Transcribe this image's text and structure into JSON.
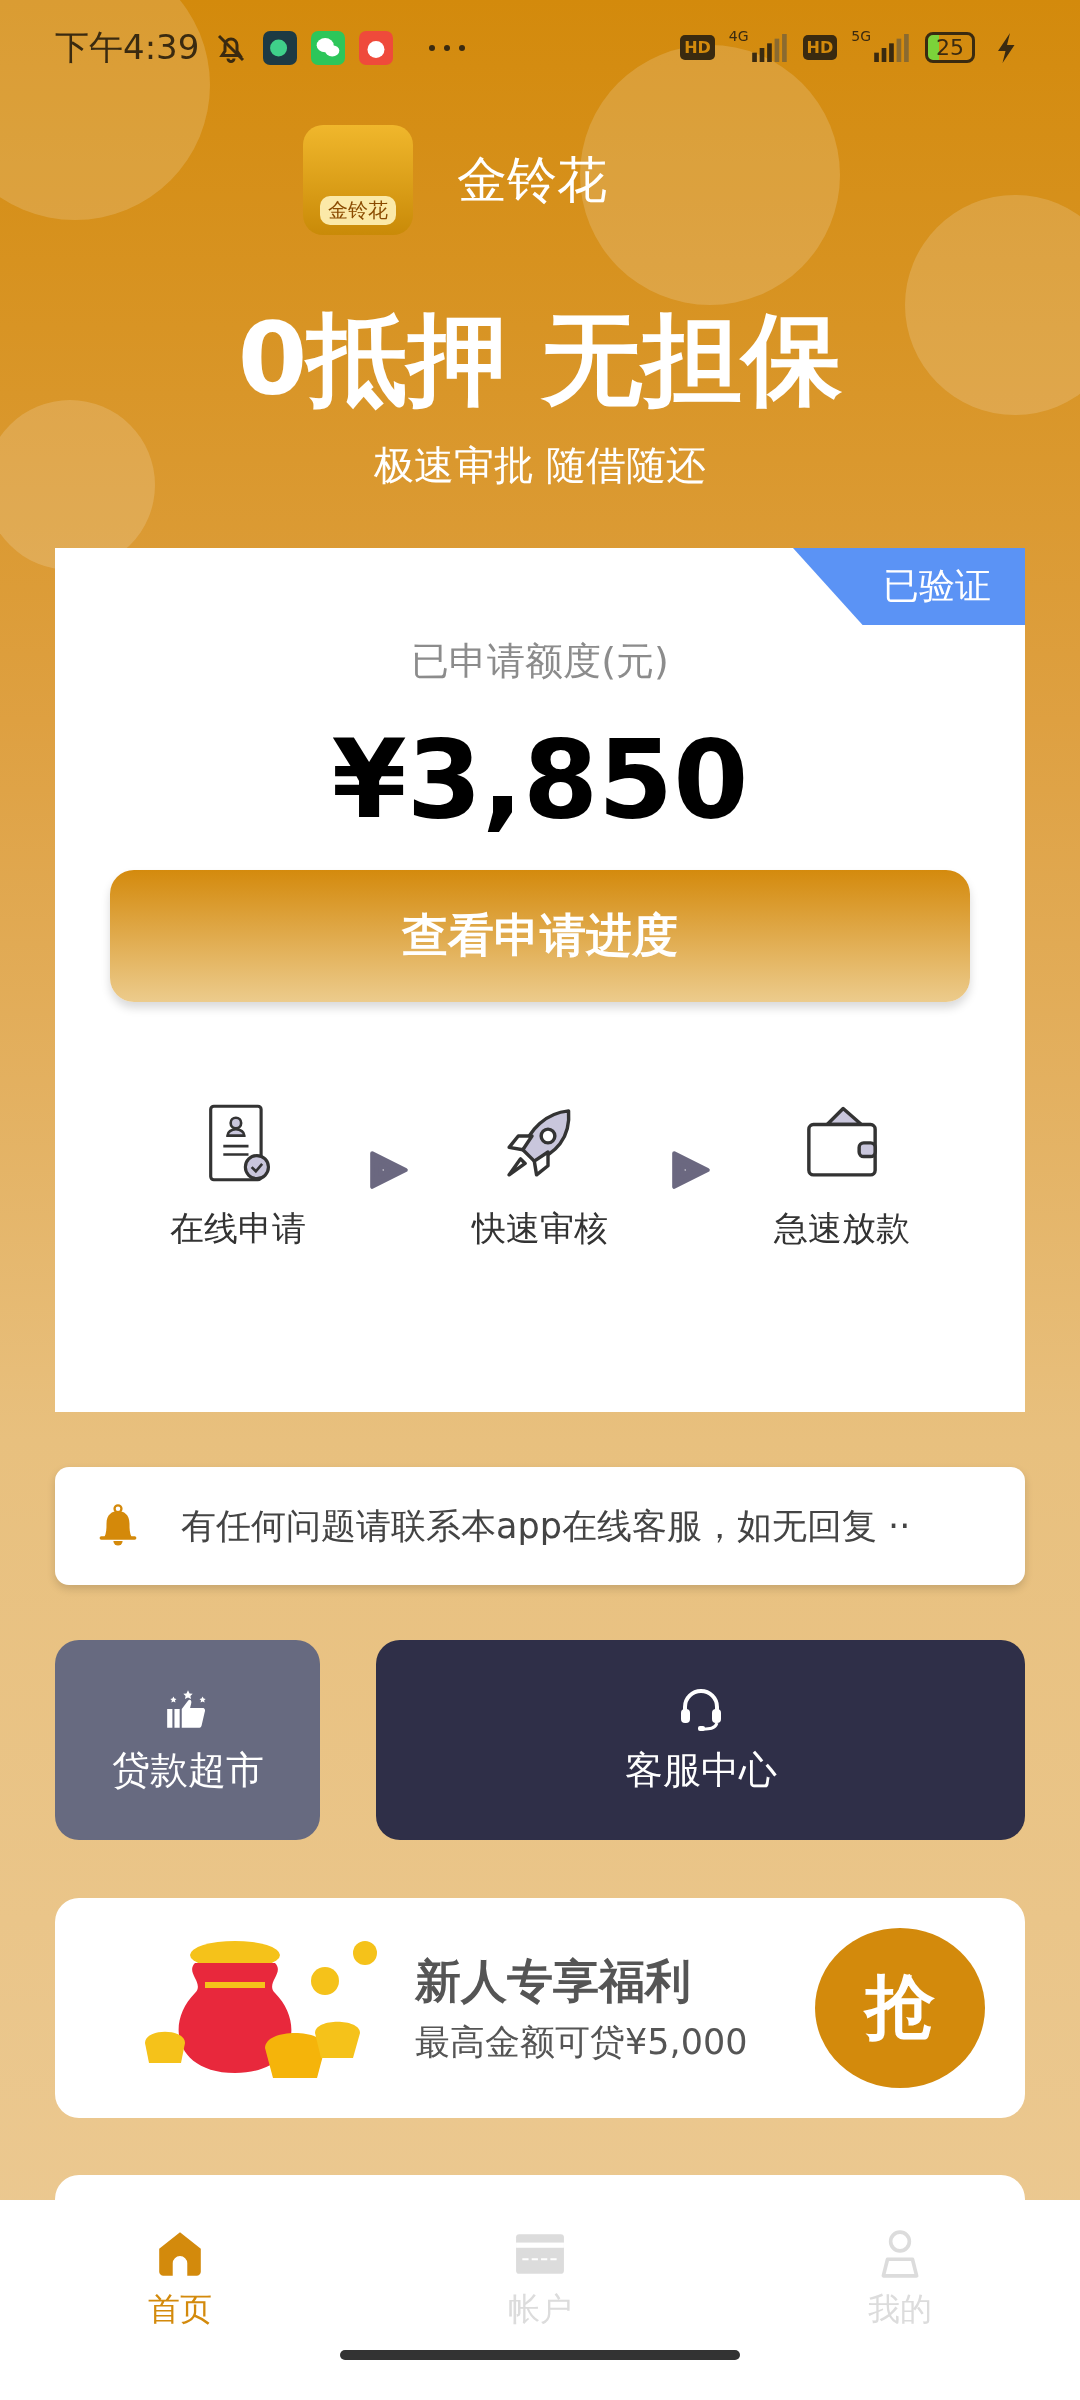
{
  "status_bar": {
    "time": "下午4:39",
    "signals": [
      {
        "hd": "HD",
        "network": "4G"
      },
      {
        "hd": "HD",
        "network": "5G"
      }
    ],
    "battery": "25"
  },
  "header": {
    "app_name": "金铃花",
    "logo_text": "金铃花",
    "headline": "0抵押 无担保",
    "subline": "极速审批 随借随还"
  },
  "credit_card": {
    "badge": "已验证",
    "label": "已申请额度(元)",
    "amount": "¥3,850",
    "button": "查看申请进度",
    "steps": [
      {
        "kind": "apply",
        "label": "在线申请"
      },
      {
        "kind": "review",
        "label": "快速审核"
      },
      {
        "kind": "payout",
        "label": "急速放款"
      }
    ]
  },
  "notice": {
    "text": "有任何问题请联系本app在线客服，如无回复 ··"
  },
  "shortcuts": [
    {
      "kind": "market",
      "label": "贷款超市"
    },
    {
      "kind": "service",
      "label": "客服中心"
    }
  ],
  "promo": {
    "title": "新人专享福利",
    "subtitle": "最高金额可贷¥5,000",
    "button": "抢"
  },
  "bottom_nav": [
    {
      "kind": "home",
      "label": "首页",
      "selected": true
    },
    {
      "kind": "account",
      "label": "帐户",
      "selected": false
    },
    {
      "kind": "profile",
      "label": "我的",
      "selected": false
    }
  ]
}
